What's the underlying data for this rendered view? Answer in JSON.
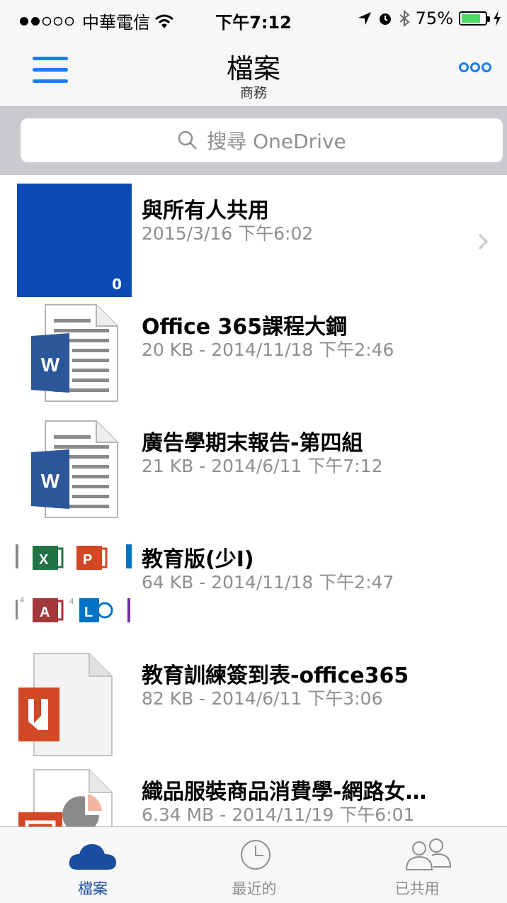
{
  "status_bar": {
    "carrier": "中華電信",
    "time": "下午7:12",
    "battery": "75%"
  },
  "nav": {
    "title": "檔案",
    "subtitle": "商務"
  },
  "search": {
    "placeholder": "搜尋 OneDrive"
  },
  "files": [
    {
      "name": "與所有人共用",
      "meta": "2015/3/16 下午6:02",
      "type": "folder",
      "count": "0"
    },
    {
      "name": "Office 365課程大鋼",
      "meta": "20 KB - 2014/11/18 下午2:46",
      "type": "word"
    },
    {
      "name": "廣告學期末報告-第四組",
      "meta": "21 KB - 2014/6/11 下午7:12",
      "type": "word"
    },
    {
      "name": "教育版(少I)",
      "meta": "64 KB - 2014/11/18 下午2:47",
      "type": "image"
    },
    {
      "name": "教育訓練簽到表-office365",
      "meta": "82 KB - 2014/6/11 下午3:06",
      "type": "pdf"
    },
    {
      "name": "織品服裝商品消費學-網路女…",
      "meta": "6.34 MB - 2014/11/19 下午6:01",
      "type": "powerpoint"
    }
  ],
  "tabs": [
    {
      "label": "檔案",
      "icon": "cloud-icon",
      "active": true
    },
    {
      "label": "最近的",
      "icon": "clock-icon",
      "active": false
    },
    {
      "label": "已共用",
      "icon": "people-icon",
      "active": false
    }
  ],
  "colors": {
    "accent": "#1a7cf2",
    "folder": "#0a4bb3",
    "word": "#2b579a",
    "excel": "#217346",
    "powerpoint": "#d24726",
    "access": "#a4373a",
    "lync": "#0072c6"
  }
}
